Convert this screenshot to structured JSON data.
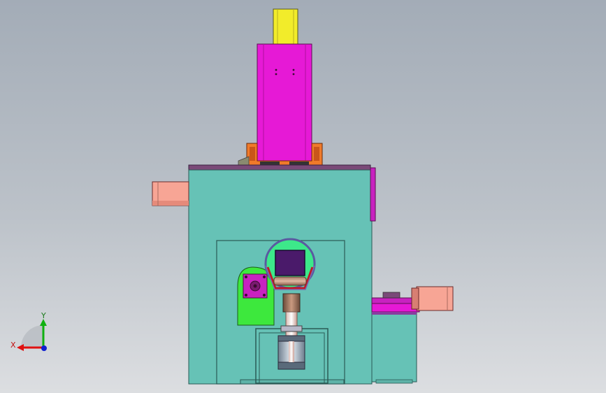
{
  "viewport": {
    "background_top": "#a4adb8",
    "background_bottom": "#d9dce0",
    "colors": {
      "yellow_part": "#f2ec2a",
      "magenta_part": "#e619d6",
      "orange_part": "#f07a2a",
      "teal_housing": "#66c2b6",
      "salmon_part": "#f7a595",
      "green_part": "#3de83d",
      "purple_part": "#8a3ca0",
      "dark_plate": "#7a4a78"
    }
  },
  "triad": {
    "x_label": "X",
    "y_label": "Y",
    "x_color": "#e01010",
    "y_color": "#10b010",
    "z_color": "#1020d0"
  }
}
